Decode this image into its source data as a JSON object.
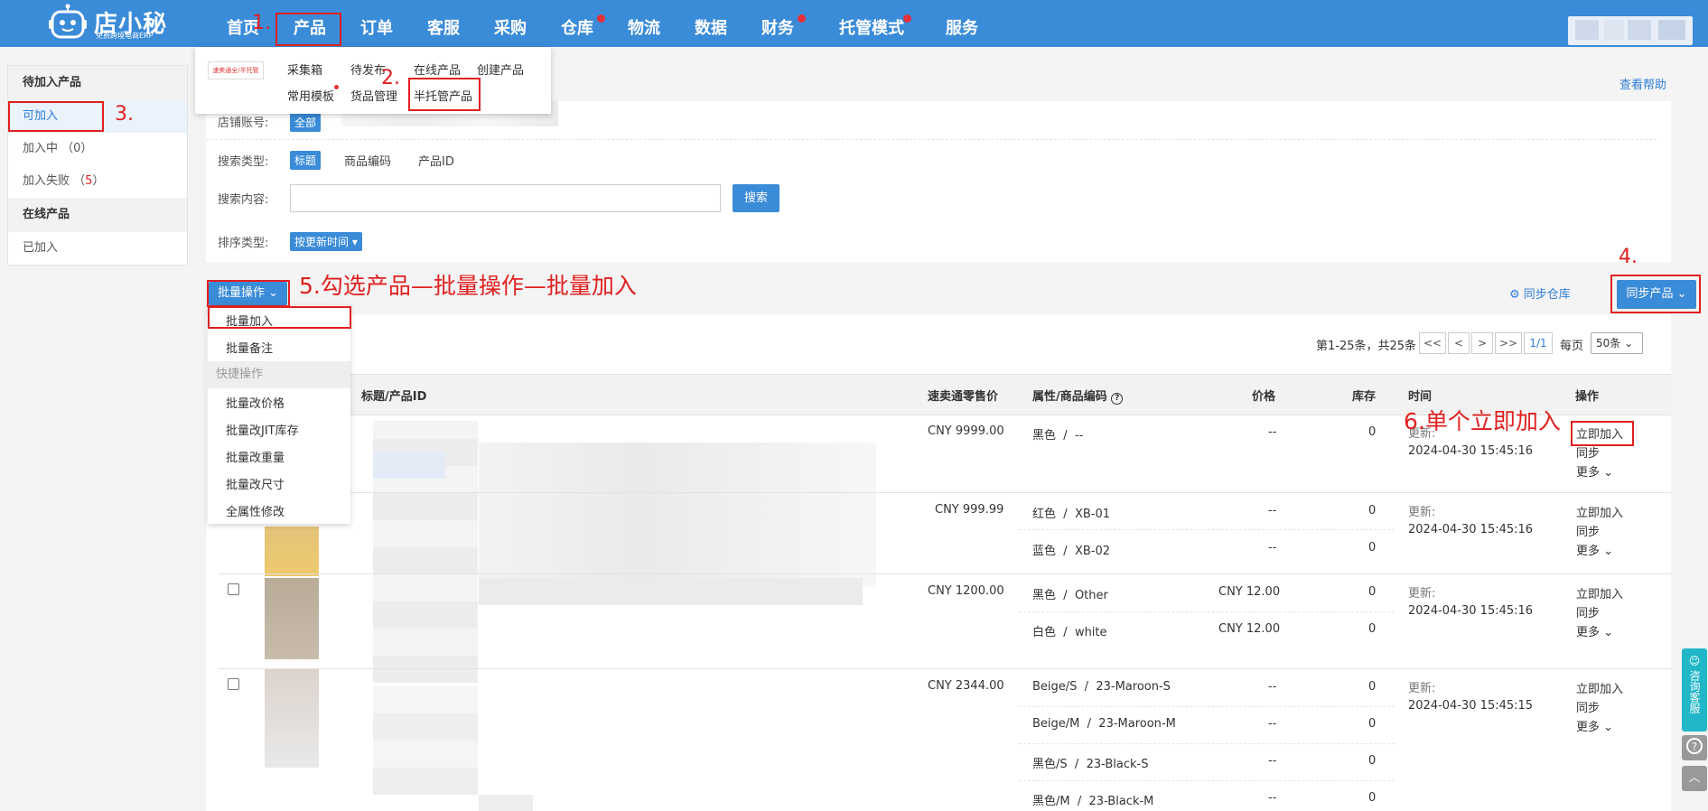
{
  "logo": {
    "name": "店小秘",
    "tagline": "免费跨境电商ERP"
  },
  "nav": [
    {
      "label": "首页",
      "dot": false
    },
    {
      "label": "产品",
      "dot": false
    },
    {
      "label": "订单",
      "dot": false
    },
    {
      "label": "客服",
      "dot": false
    },
    {
      "label": "采购",
      "dot": false
    },
    {
      "label": "仓库",
      "dot": true
    },
    {
      "label": "物流",
      "dot": false
    },
    {
      "label": "数据",
      "dot": false
    },
    {
      "label": "财务",
      "dot": true
    },
    {
      "label": "托管模式",
      "dot": true
    },
    {
      "label": "服务",
      "dot": false
    }
  ],
  "product_menu": {
    "badge": "速卖通全/半托管",
    "items": [
      "采集箱",
      "待发布",
      "在线产品",
      "创建产品",
      "常用模板",
      "货品管理",
      "半托管产品"
    ]
  },
  "sidebar": {
    "groups": [
      {
        "title": "待加入产品",
        "items": [
          {
            "label": "可加入",
            "count": ""
          },
          {
            "label": "加入中",
            "count": "（0）"
          },
          {
            "label": "加入失败",
            "count": "5"
          }
        ]
      },
      {
        "title": "在线产品",
        "items": [
          {
            "label": "已加入",
            "count": ""
          }
        ]
      }
    ]
  },
  "help_link": "查看帮助",
  "filters": {
    "store_label": "店铺账号:",
    "store_all": "全部",
    "search_type_label": "搜索类型:",
    "search_types": [
      "标题",
      "商品编码",
      "产品ID"
    ],
    "search_content_label": "搜索内容:",
    "search_value": "",
    "search_button": "搜索",
    "sort_label": "排序类型:",
    "sort_value": "按更新时间"
  },
  "toolbar": {
    "batch_button": "批量操作",
    "sync_warehouse": "同步仓库",
    "sync_products": "同步产品"
  },
  "batch_menu": {
    "items_top": [
      "批量加入",
      "批量备注"
    ],
    "quick_title": "快捷操作",
    "items_quick": [
      "批量改价格",
      "批量改JIT库存",
      "批量改重量",
      "批量改尺寸",
      "全属性修改"
    ]
  },
  "pager": {
    "summary": "第1-25条，共25条",
    "first": "<<",
    "prev": "<",
    "next": ">",
    "last": ">>",
    "page": "1/1",
    "per_page_label": "每页",
    "per_page_value": "50条"
  },
  "table": {
    "headers": {
      "title": "标题/产品ID",
      "retail": "速卖通零售价",
      "attr": "属性/商品编码",
      "price": "价格",
      "stock": "库存",
      "time": "时间",
      "ops": "操作"
    },
    "time_prefix": "更新:",
    "ops": {
      "join": "立即加入",
      "sync": "同步",
      "more": "更多"
    },
    "rows": [
      {
        "retail": "CNY 9999.00",
        "time": "2024-04-30 15:45:16",
        "variants": [
          {
            "attr": "黑色",
            "code": "--",
            "price": "--",
            "stock": "0"
          }
        ]
      },
      {
        "retail": "CNY 999.99",
        "time": "2024-04-30 15:45:16",
        "variants": [
          {
            "attr": "红色",
            "code": "XB-01",
            "price": "--",
            "stock": "0"
          },
          {
            "attr": "蓝色",
            "code": "XB-02",
            "price": "--",
            "stock": "0"
          }
        ]
      },
      {
        "retail": "CNY 1200.00",
        "time": "2024-04-30 15:45:16",
        "variants": [
          {
            "attr": "黑色",
            "code": "Other",
            "price": "CNY 12.00",
            "stock": "0"
          },
          {
            "attr": "白色",
            "code": "white",
            "price": "CNY 12.00",
            "stock": "0"
          }
        ]
      },
      {
        "retail": "CNY 2344.00",
        "time": "2024-04-30 15:45:15",
        "variants": [
          {
            "attr": "Beige/S",
            "code": "23-Maroon-S",
            "price": "--",
            "stock": "0"
          },
          {
            "attr": "Beige/M",
            "code": "23-Maroon-M",
            "price": "--",
            "stock": "0"
          },
          {
            "attr": "黑色/S",
            "code": "23-Black-S",
            "price": "--",
            "stock": "0"
          },
          {
            "attr": "黑色/M",
            "code": "23-Black-M",
            "price": "--",
            "stock": "0"
          }
        ]
      }
    ]
  },
  "annotations": {
    "a1": "1.",
    "a2": "2.",
    "a3": "3.",
    "a4": "4.",
    "a5": "5.勾选产品—批量操作—批量加入",
    "a6": "6.单个立即加入"
  },
  "float": {
    "service": "咨询客服",
    "help": "?"
  }
}
